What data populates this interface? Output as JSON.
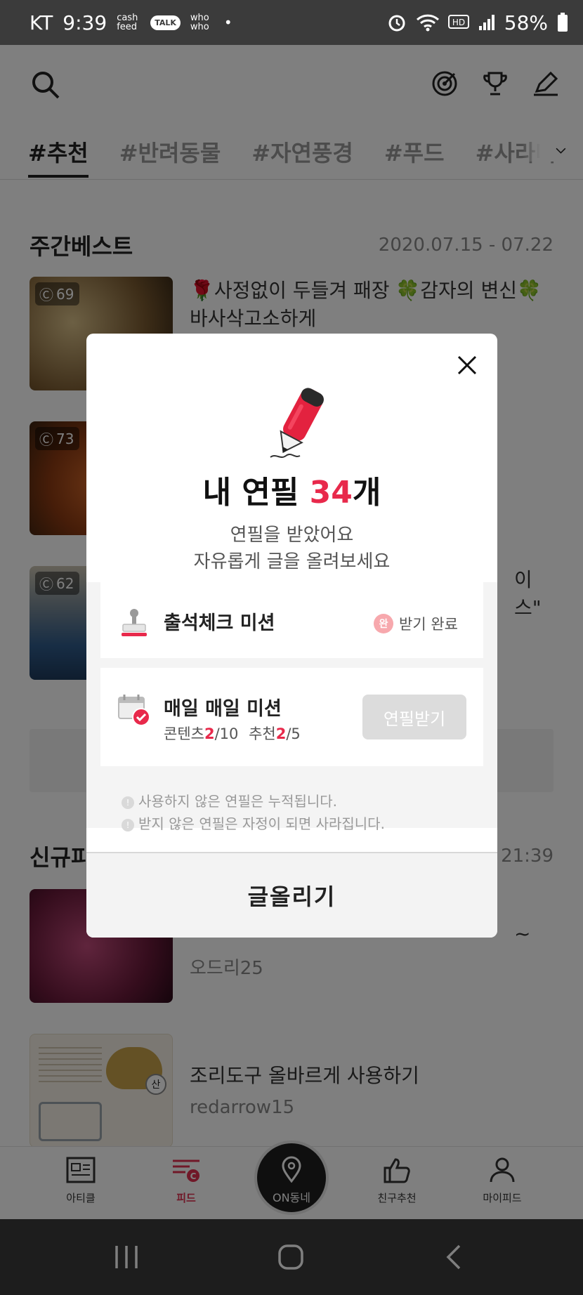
{
  "status_bar": {
    "carrier": "KT",
    "time": "9:39",
    "notif_cashfeed": "cash feed",
    "notif_talk": "TALK",
    "notif_whowho": "who who",
    "battery": "58%"
  },
  "tabs": [
    "#추천",
    "#반려동물",
    "#자연풍경",
    "#푸드",
    "#사라미"
  ],
  "weekly": {
    "title": "주간베스트",
    "date": "2020.07.15 - 07.22",
    "items": [
      {
        "badge": "69",
        "title": "🌹사정없이 두들겨 패장 🍀감자의 변신🍀바사삭고소하게"
      },
      {
        "badge": "73",
        "title": ""
      },
      {
        "badge": "62",
        "title": "이스\""
      }
    ]
  },
  "new_section": {
    "title": "신규피",
    "time": "21:39",
    "items": [
      {
        "title": "~",
        "author": "오드리25"
      },
      {
        "title": "조리도구 올바르게 사용하기",
        "author": "redarrow15",
        "thumb_badge": "산"
      }
    ]
  },
  "bottom_nav": {
    "article": "아티클",
    "feed": "피드",
    "on_dongne": "ON동네",
    "friends": "친구추천",
    "my_feed": "마이피드"
  },
  "modal": {
    "heading_prefix": "내 연필 ",
    "count": "34",
    "heading_suffix": "개",
    "desc_line1": "연필을 받았어요",
    "desc_line2": "자유롭게 글을 올려보세요",
    "attendance_mission": "출석체크 미션",
    "done_mark": "완",
    "done_label": "받기 완료",
    "daily_mission": "매일 매일 미션",
    "stats": {
      "content_label": "콘텐츠",
      "content_done": "2",
      "content_total": "/10",
      "recommend_label": "추천",
      "recommend_done": "2",
      "recommend_total": "/5"
    },
    "get_button": "연필받기",
    "note1": "사용하지 않은 연필은 누적됩니다.",
    "note2": "받지 않은 연필은 자정이 되면 사라집니다.",
    "post_button": "글올리기"
  },
  "colors": {
    "accent": "#e8294b",
    "statusbar": "#3b3b3b"
  }
}
